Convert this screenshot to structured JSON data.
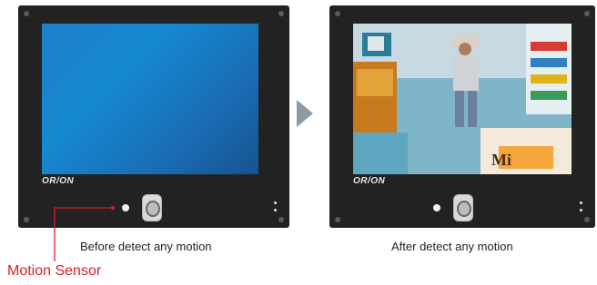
{
  "left_panel": {
    "brand": "OR/ON",
    "caption": "Before detect any motion",
    "screen_state": "blank-blue"
  },
  "right_panel": {
    "brand": "OR/ON",
    "caption": "After detect any motion",
    "screen_state": "surveillance-video",
    "scene_text": "Mi"
  },
  "callout": {
    "label": "Motion Sensor",
    "color": "#e01b24"
  },
  "arrow": {
    "icon": "play-arrow-icon",
    "color": "#8e9aa3"
  },
  "colors": {
    "bezel": "#222222",
    "screen_blue": "#1b7cc4"
  }
}
